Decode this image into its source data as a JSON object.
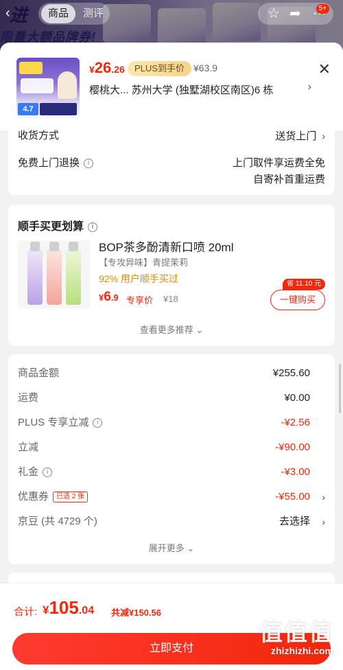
{
  "top": {
    "tab_goods": "商品",
    "tab_review": "测评",
    "badge": "5+",
    "promo_line1": "进",
    "promo_line2": "限量大额品牌券!"
  },
  "sheet": {
    "price_yen": "¥",
    "price_int": "26",
    "price_dec": ".26",
    "plus_tag": "PLUS到手价",
    "orig_price": "¥63.9",
    "headline": "樱桃大...  苏州大学 (独墅湖校区南区)6 栋",
    "thumb_rating": "4.7"
  },
  "delivery": {
    "method_label": "收货方式",
    "method_value": "送货上门",
    "return_label": "免费上门退换",
    "return_value_line1": "上门取件享运费全免",
    "return_value_line2": "自寄补首重运费"
  },
  "addon": {
    "title": "顺手买更划算",
    "product_name": "BOP茶多酚清新口喷 20ml",
    "spec": "【专攻异味】青提茉莉",
    "rate": "92% 用户顺手买过",
    "price_yen": "¥",
    "price_int": "6",
    "price_dec": ".9",
    "price_tag": "专享价",
    "orig_price": "¥18",
    "save_tag": "省 11.10 元",
    "buy_label": "一键购买",
    "more_label": "查看更多推荐"
  },
  "summary": {
    "rows": [
      {
        "label": "商品金额",
        "value": "¥255.60"
      },
      {
        "label": "运费",
        "value": "¥0.00"
      },
      {
        "label": "PLUS 专享立减",
        "value": "-¥2.56"
      },
      {
        "label": "立减",
        "value": "-¥90.00"
      },
      {
        "label": "礼金",
        "value": "-¥3.00"
      },
      {
        "label": "优惠券",
        "value": "-¥55.00",
        "tag": "已选 2 张"
      },
      {
        "label": "京豆 (共 4729 个)",
        "value": "去选择"
      }
    ],
    "expand_label": "展开更多"
  },
  "footer": {
    "total_label": "合计:",
    "total_yen": "¥",
    "total_int": "105",
    "total_dec": ".04",
    "total_reduce": "共减¥150.56",
    "pay_label": "立即支付",
    "watermark_text": "值值值",
    "watermark_url": "zhizhizhi.com"
  },
  "colors": {
    "accent_red": "#f2270c",
    "plus_gold": "#f8d38a",
    "rate_orange": "#e38a00"
  }
}
